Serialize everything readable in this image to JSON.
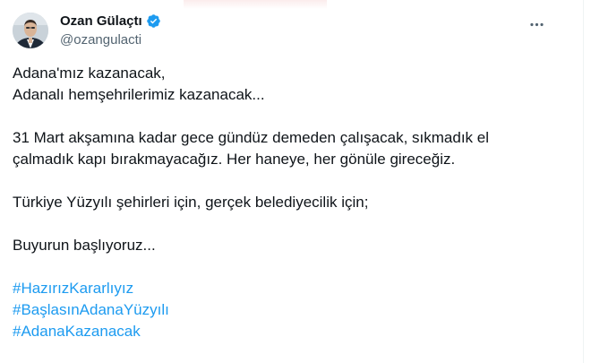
{
  "author": {
    "display_name": "Ozan Gülaçtı",
    "handle": "@ozangulacti",
    "verified": true,
    "verified_color": "#1d9bf0"
  },
  "menu": {
    "icon": "more-horizontal-icon"
  },
  "tweet": {
    "paragraphs": [
      [
        "Adana'mız kazanacak,",
        "Adanalı hemşehrilerimiz kazanacak..."
      ],
      [
        "31 Mart akşamına kadar gece gündüz demeden çalışacak, sıkmadık el",
        "çalmadık kapı bırakmayacağız. Her haneye, her gönüle gireceğiz."
      ],
      [
        "Türkiye Yüzyılı şehirleri için, gerçek belediyecilik için;"
      ],
      [
        "Buyurun başlıyoruz..."
      ]
    ],
    "hashtags": [
      "#HazırızKararlıyız",
      "#BaşlasınAdanaYüzyılı",
      "#AdanaKazanacak"
    ]
  },
  "colors": {
    "text": "#0f1419",
    "secondary_text": "#536471",
    "link": "#1d9bf0"
  }
}
